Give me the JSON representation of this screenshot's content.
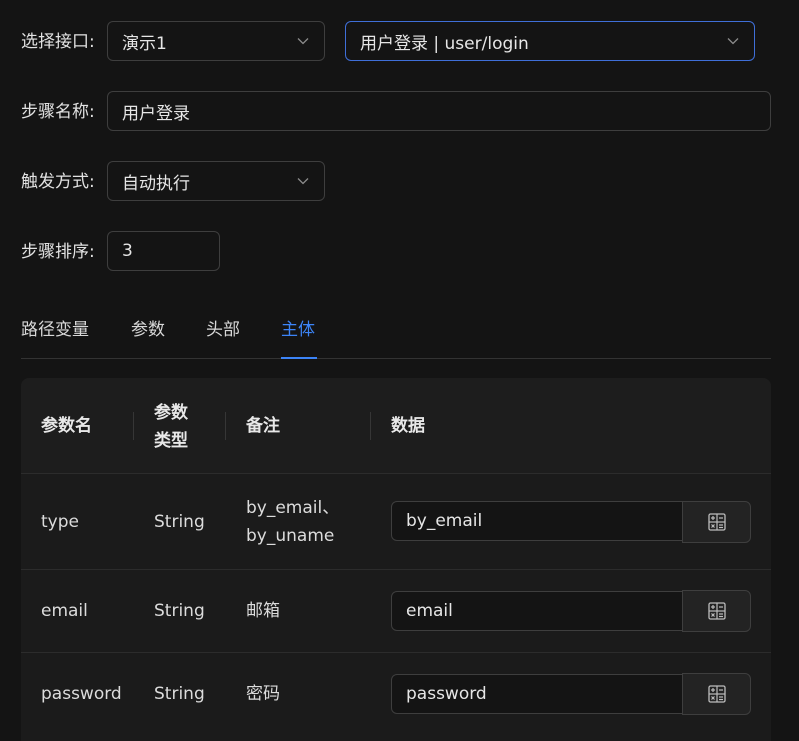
{
  "form": {
    "interface_label": "选择接口:",
    "interface_project": "演示1",
    "interface_endpoint": "用户登录 | user/login",
    "step_name_label": "步骤名称:",
    "step_name_value": "用户登录",
    "trigger_label": "触发方式:",
    "trigger_value": "自动执行",
    "order_label": "步骤排序:",
    "order_value": "3"
  },
  "tabs": [
    {
      "label": "路径变量",
      "active": false
    },
    {
      "label": "参数",
      "active": false
    },
    {
      "label": "头部",
      "active": false
    },
    {
      "label": "主体",
      "active": true
    }
  ],
  "table": {
    "headers": {
      "name": "参数名",
      "type_line1": "参数",
      "type_line2": "类型",
      "note": "备注",
      "data": "数据"
    },
    "rows": [
      {
        "name": "type",
        "type": "String",
        "note_line1": "by_email、",
        "note_line2": "by_uname",
        "data": "by_email"
      },
      {
        "name": "email",
        "type": "String",
        "note_line1": "邮箱",
        "data": "email"
      },
      {
        "name": "password",
        "type": "String",
        "note_line1": "密码",
        "data": "password"
      }
    ]
  },
  "icons": {
    "select_arrow": "chevron-down-icon",
    "data_button": "calculator-icon"
  },
  "colors": {
    "background": "#141414",
    "accent": "#3c84f7",
    "focus_border": "#3f6fd8",
    "table_background": "#1b1b1b"
  }
}
